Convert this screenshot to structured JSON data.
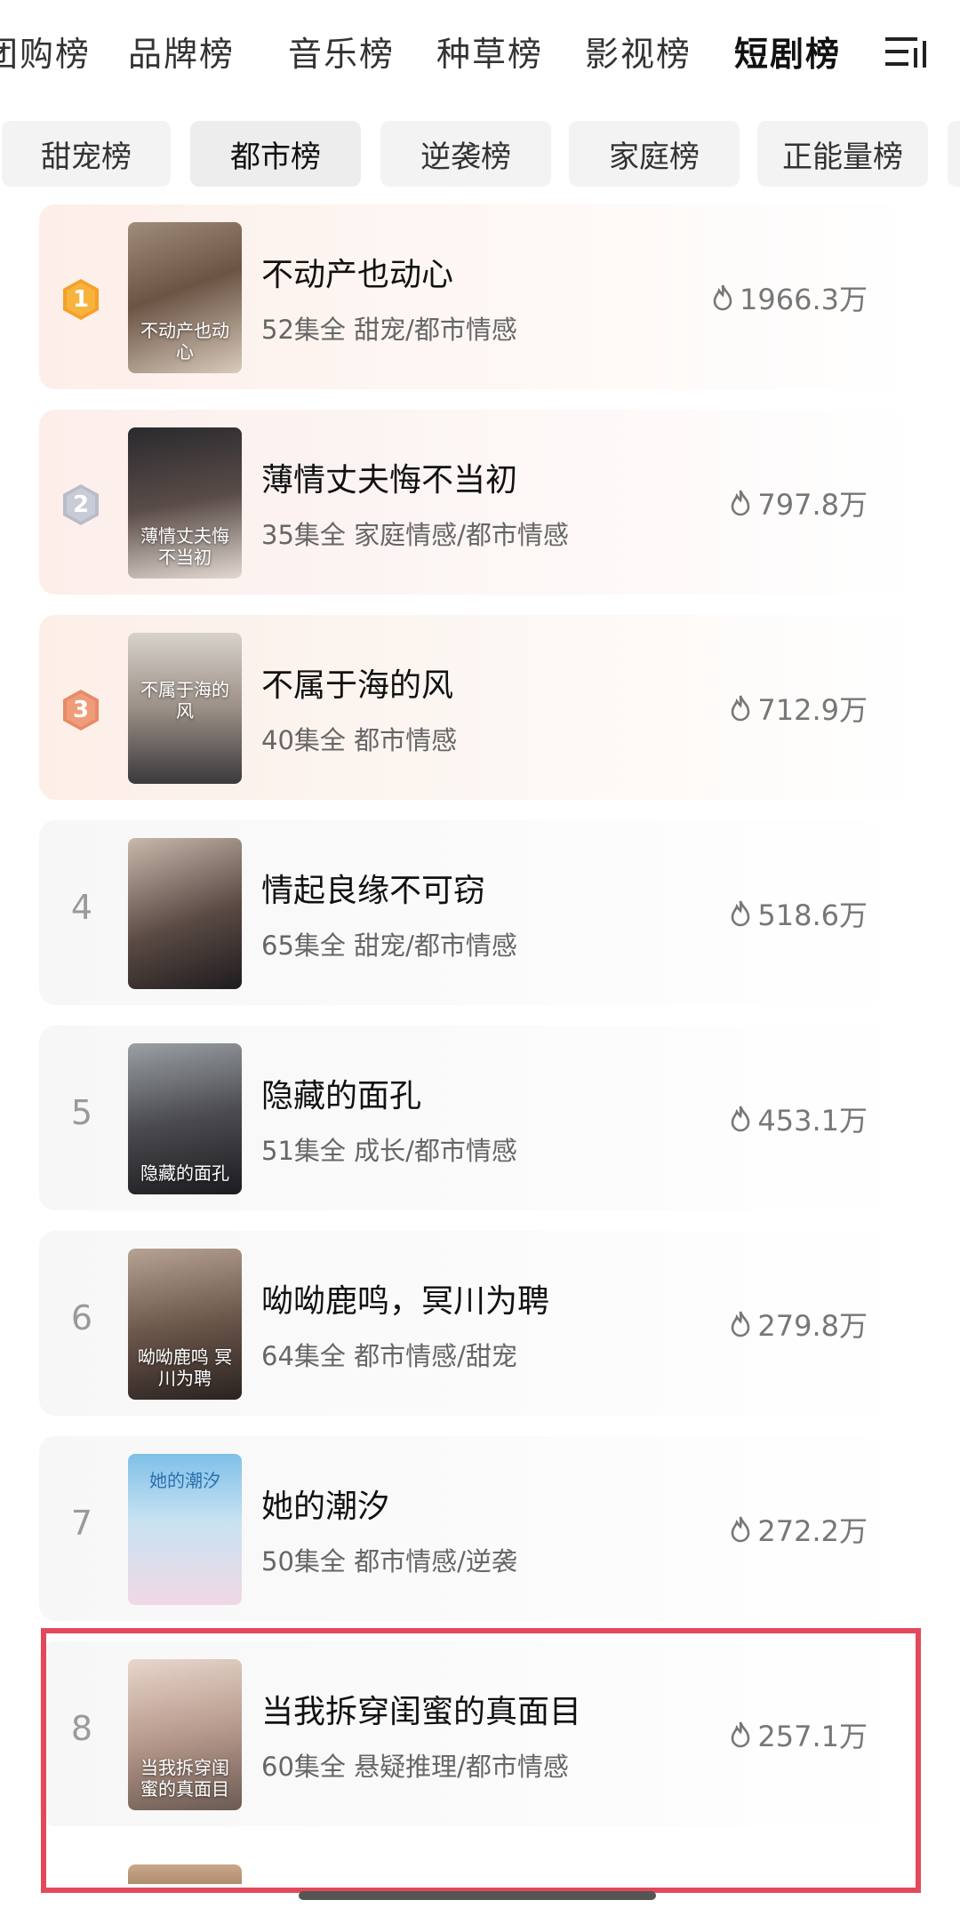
{
  "top_tabs": [
    "团购榜",
    "品牌榜",
    "音乐榜",
    "种草榜",
    "影视榜",
    "短剧榜"
  ],
  "top_tabs_active": "短剧榜",
  "categories": [
    "甜宠榜",
    "都市榜",
    "逆袭榜",
    "家庭榜",
    "正能量榜"
  ],
  "categories_active": "都市榜",
  "list": [
    {
      "rank": "1",
      "title": "不动产也动心",
      "meta": "52集全 甜宠/都市情感",
      "heat": "1966.3万",
      "poster_caption": "不动产也动心"
    },
    {
      "rank": "2",
      "title": "薄情丈夫悔不当初",
      "meta": "35集全 家庭情感/都市情感",
      "heat": "797.8万",
      "poster_caption": "薄情丈夫悔不当初"
    },
    {
      "rank": "3",
      "title": "不属于海的风",
      "meta": "40集全 都市情感",
      "heat": "712.9万",
      "poster_caption": "不属于海的风"
    },
    {
      "rank": "4",
      "title": "情起良缘不可窃",
      "meta": "65集全 甜宠/都市情感",
      "heat": "518.6万",
      "poster_caption": ""
    },
    {
      "rank": "5",
      "title": "隐藏的面孔",
      "meta": "51集全 成长/都市情感",
      "heat": "453.1万",
      "poster_caption": "隐藏的面孔"
    },
    {
      "rank": "6",
      "title": "呦呦鹿鸣，冥川为聘",
      "meta": "64集全 都市情感/甜宠",
      "heat": "279.8万",
      "poster_caption": "呦呦鹿鸣 冥川为聘"
    },
    {
      "rank": "7",
      "title": "她的潮汐",
      "meta": "50集全 都市情感/逆袭",
      "heat": "272.2万",
      "poster_caption": "她的潮汐"
    },
    {
      "rank": "8",
      "title": "当我拆穿闺蜜的真面目",
      "meta": "60集全 悬疑推理/都市情感",
      "heat": "257.1万",
      "poster_caption": "当我拆穿闺蜜的真面目"
    }
  ],
  "colors": {
    "rank1": "#f4a02a",
    "rank2": "#b8bcc8",
    "rank3": "#e88a66",
    "highlight": "#e24a5b"
  }
}
